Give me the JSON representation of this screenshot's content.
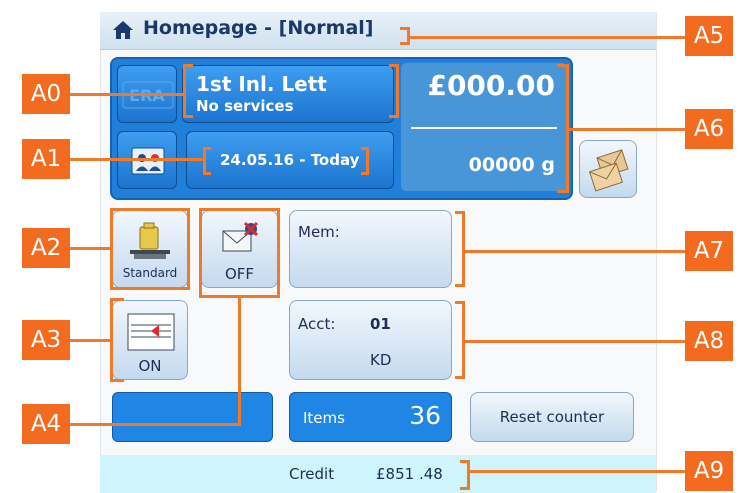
{
  "title": "Homepage - [Normal]",
  "icons": {
    "home": "home-icon",
    "era": "era-logo-icon",
    "id": "id-card-icon",
    "scale": "scale-icon",
    "no_mail": "no-mail-icon",
    "marker": "arrow-marker-icon",
    "envelopes": "envelopes-icon"
  },
  "panel": {
    "era_logo": "ERA",
    "service_title": "1st Inl. Lett",
    "service_sub": "No services",
    "date": "24.05.16 - Today",
    "price": "£000.00",
    "weight": "00000 g"
  },
  "buttons": {
    "weigh_label": "Standard",
    "mail_state": "OFF",
    "marker_state": "ON",
    "mem_label": "Mem:",
    "acct_label": "Acct:",
    "acct_number": "01",
    "acct_name": "KD",
    "items_label": "Items",
    "items_count": "36",
    "reset_label": "Reset counter"
  },
  "footer": {
    "credit_label": "Credit",
    "credit_value": "£851 .48"
  },
  "annotations": [
    "A0",
    "A1",
    "A2",
    "A3",
    "A4",
    "A5",
    "A6",
    "A7",
    "A8",
    "A9"
  ],
  "colors": {
    "panel_blue": "#1f7fd9",
    "annotation_orange": "#f26b1f",
    "title_navy": "#1a3868"
  }
}
